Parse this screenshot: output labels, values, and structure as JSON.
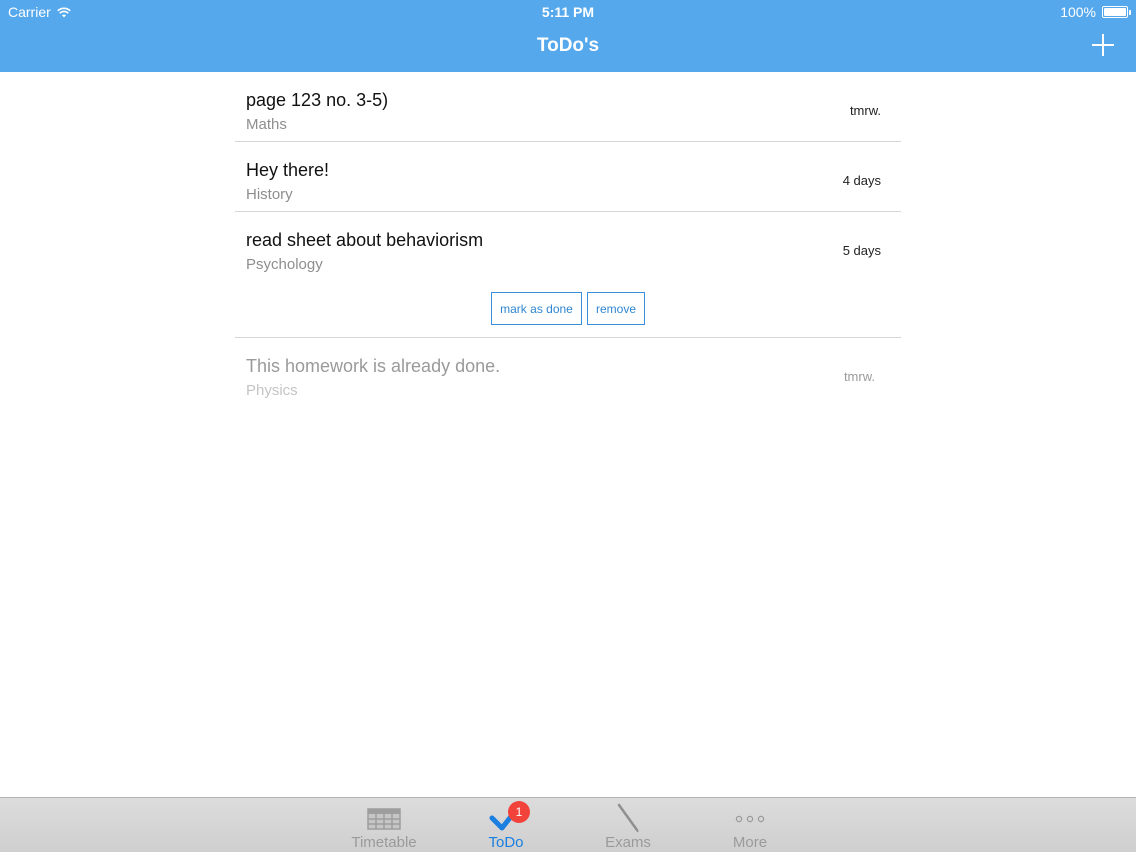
{
  "status": {
    "carrier": "Carrier",
    "time": "5:11 PM",
    "battery": "100%"
  },
  "nav": {
    "title": "ToDo's",
    "add_icon": "plus-icon"
  },
  "todos": [
    {
      "title": "page 123 no. 3-5)",
      "subject": "Maths",
      "due": "tmrw.",
      "done": false
    },
    {
      "title": "Hey there!",
      "subject": "History",
      "due": "4 days",
      "done": false
    },
    {
      "title": "read sheet about behaviorism",
      "subject": "Psychology",
      "due": "5 days",
      "done": false
    },
    {
      "title": "This homework is already done.",
      "subject": "Physics",
      "due": "tmrw.",
      "done": true
    }
  ],
  "actions": {
    "mark_done": "mark as done",
    "remove": "remove"
  },
  "tabs": [
    {
      "label": "Timetable",
      "icon": "table-icon",
      "active": false
    },
    {
      "label": "ToDo",
      "icon": "checkmark-icon",
      "active": true,
      "badge": "1"
    },
    {
      "label": "Exams",
      "icon": "pen-icon",
      "active": false
    },
    {
      "label": "More",
      "icon": "ellipsis-icon",
      "active": false
    }
  ],
  "colors": {
    "accent": "#56a8ec",
    "active_tab": "#1a7fe0",
    "badge": "#f2433a"
  }
}
